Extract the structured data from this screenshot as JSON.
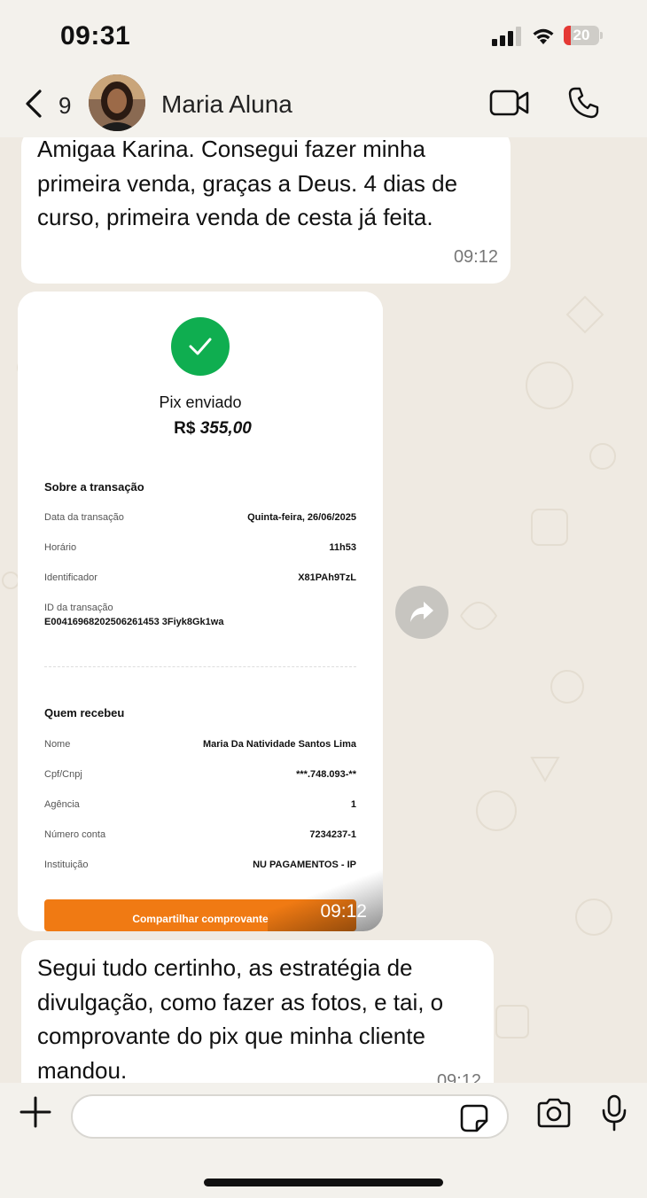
{
  "status": {
    "time": "09:31",
    "battery": "20"
  },
  "header": {
    "back_count": "9",
    "contact_name": "Maria Aluna"
  },
  "messages": [
    {
      "text": "Amigaa Karina. Consegui fazer minha primeira venda, graças a Deus. 4 dias de curso, primeira venda de cesta já feita.",
      "time": "09:12"
    },
    {
      "time": "09:12"
    },
    {
      "text": "Segui tudo certinho, as estratégia de divulgação, como fazer as fotos, e tai, o comprovante do pix que minha cliente mandou.",
      "time": "09:12"
    }
  ],
  "receipt": {
    "title": "Pix enviado",
    "currency": "R$",
    "amount": "355,00",
    "transaction_section": "Sobre a transação",
    "transaction_rows": [
      {
        "label": "Data da transação",
        "value": "Quinta-feira, 26/06/2025"
      },
      {
        "label": "Horário",
        "value": "11h53"
      },
      {
        "label": "Identificador",
        "value": "X81PAh9TzL"
      },
      {
        "label": "ID da transação",
        "value": "E00416968202506261453 3Fiyk8Gk1wa"
      }
    ],
    "recipient_section": "Quem recebeu",
    "recipient_rows": [
      {
        "label": "Nome",
        "value": "Maria Da Natividade Santos Lima"
      },
      {
        "label": "Cpf/Cnpj",
        "value": "***.748.093-**"
      },
      {
        "label": "Agência",
        "value": "1"
      },
      {
        "label": "Número conta",
        "value": "7234237-1"
      },
      {
        "label": "Instituição",
        "value": "NU PAGAMENTOS - IP"
      }
    ],
    "share_button": "Compartilhar comprovante"
  },
  "colors": {
    "accent_green": "#0fae50",
    "share_orange": "#f07a13",
    "chat_bg": "#efeae2"
  }
}
